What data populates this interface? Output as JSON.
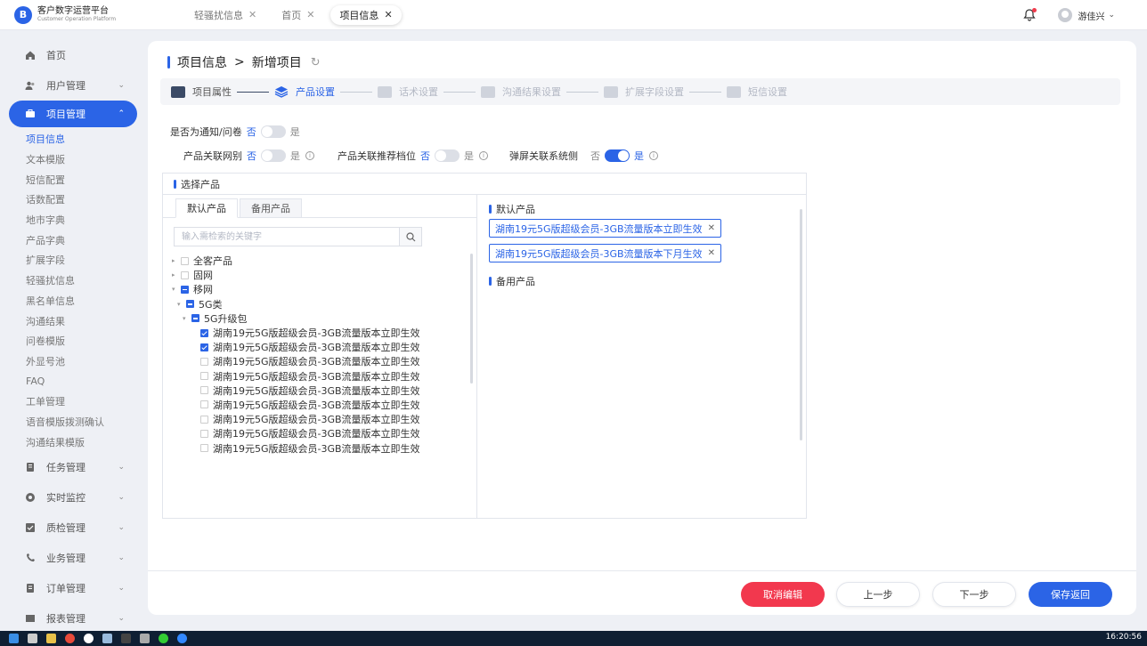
{
  "app": {
    "title": "客户数字运营平台",
    "subtitle": "Customer Operation Platform"
  },
  "tabs": [
    {
      "label": "轻骚扰信息"
    },
    {
      "label": "首页"
    },
    {
      "label": "项目信息"
    }
  ],
  "user": {
    "name": "游佳兴"
  },
  "sidebar": {
    "top_items": [
      {
        "label": "首页",
        "icon": "home-icon"
      },
      {
        "label": "用户管理",
        "icon": "users-icon"
      },
      {
        "label": "项目管理",
        "icon": "project-icon"
      }
    ],
    "sub_items": [
      "项目信息",
      "文本模版",
      "短信配置",
      "话数配置",
      "地市字典",
      "产品字典",
      "扩展字段",
      "轻骚扰信息",
      "黑名单信息",
      "沟通结果",
      "问卷模版",
      "外显号池",
      "FAQ",
      "工单管理",
      "语音模版拨测确认",
      "沟通结果模版"
    ],
    "bottom_items": [
      {
        "label": "任务管理",
        "icon": "task-icon"
      },
      {
        "label": "实时监控",
        "icon": "monitor-icon"
      },
      {
        "label": "质检管理",
        "icon": "quality-icon"
      },
      {
        "label": "业务管理",
        "icon": "business-icon"
      },
      {
        "label": "订单管理",
        "icon": "order-icon"
      },
      {
        "label": "报表管理",
        "icon": "report-icon"
      }
    ]
  },
  "breadcrumb": {
    "parent": "项目信息",
    "sep": ">",
    "current": "新增项目"
  },
  "steps": [
    "项目属性",
    "产品设置",
    "话术设置",
    "沟通结果设置",
    "扩展字段设置",
    "短信设置"
  ],
  "options": {
    "notify_label": "是否为通知/问卷",
    "network_label": "产品关联网别",
    "recommend_label": "产品关联推荐档位",
    "popup_label": "弹屏关联系统侧",
    "no": "否",
    "yes": "是"
  },
  "select_panel": {
    "title": "选择产品",
    "tab_default": "默认产品",
    "tab_backup": "备用产品",
    "search_placeholder": "输入需检索的关键字",
    "tree": {
      "n1": "全客产品",
      "n2": "固网",
      "n3": "移网",
      "n4": "5G类",
      "n5": "5G升级包",
      "leaves": [
        "湖南19元5G版超级会员-3GB流量版本立即生效",
        "湖南19元5G版超级会员-3GB流量版本立即生效",
        "湖南19元5G版超级会员-3GB流量版本立即生效",
        "湖南19元5G版超级会员-3GB流量版本立即生效",
        "湖南19元5G版超级会员-3GB流量版本立即生效",
        "湖南19元5G版超级会员-3GB流量版本立即生效",
        "湖南19元5G版超级会员-3GB流量版本立即生效",
        "湖南19元5G版超级会员-3GB流量版本立即生效",
        "湖南19元5G版超级会员-3GB流量版本立即生效"
      ]
    },
    "right_default_title": "默认产品",
    "right_backup_title": "备用产品",
    "chips": [
      "湖南19元5G版超级会员-3GB流量版本立即生效",
      "湖南19元5G版超级会员-3GB流量版本下月生效"
    ]
  },
  "footer": {
    "cancel": "取消编辑",
    "prev": "上一步",
    "next": "下一步",
    "save": "保存返回"
  },
  "taskbar": {
    "clock": "16:20:56"
  },
  "colors": {
    "primary": "#2b64e6",
    "danger": "#f2384e"
  }
}
